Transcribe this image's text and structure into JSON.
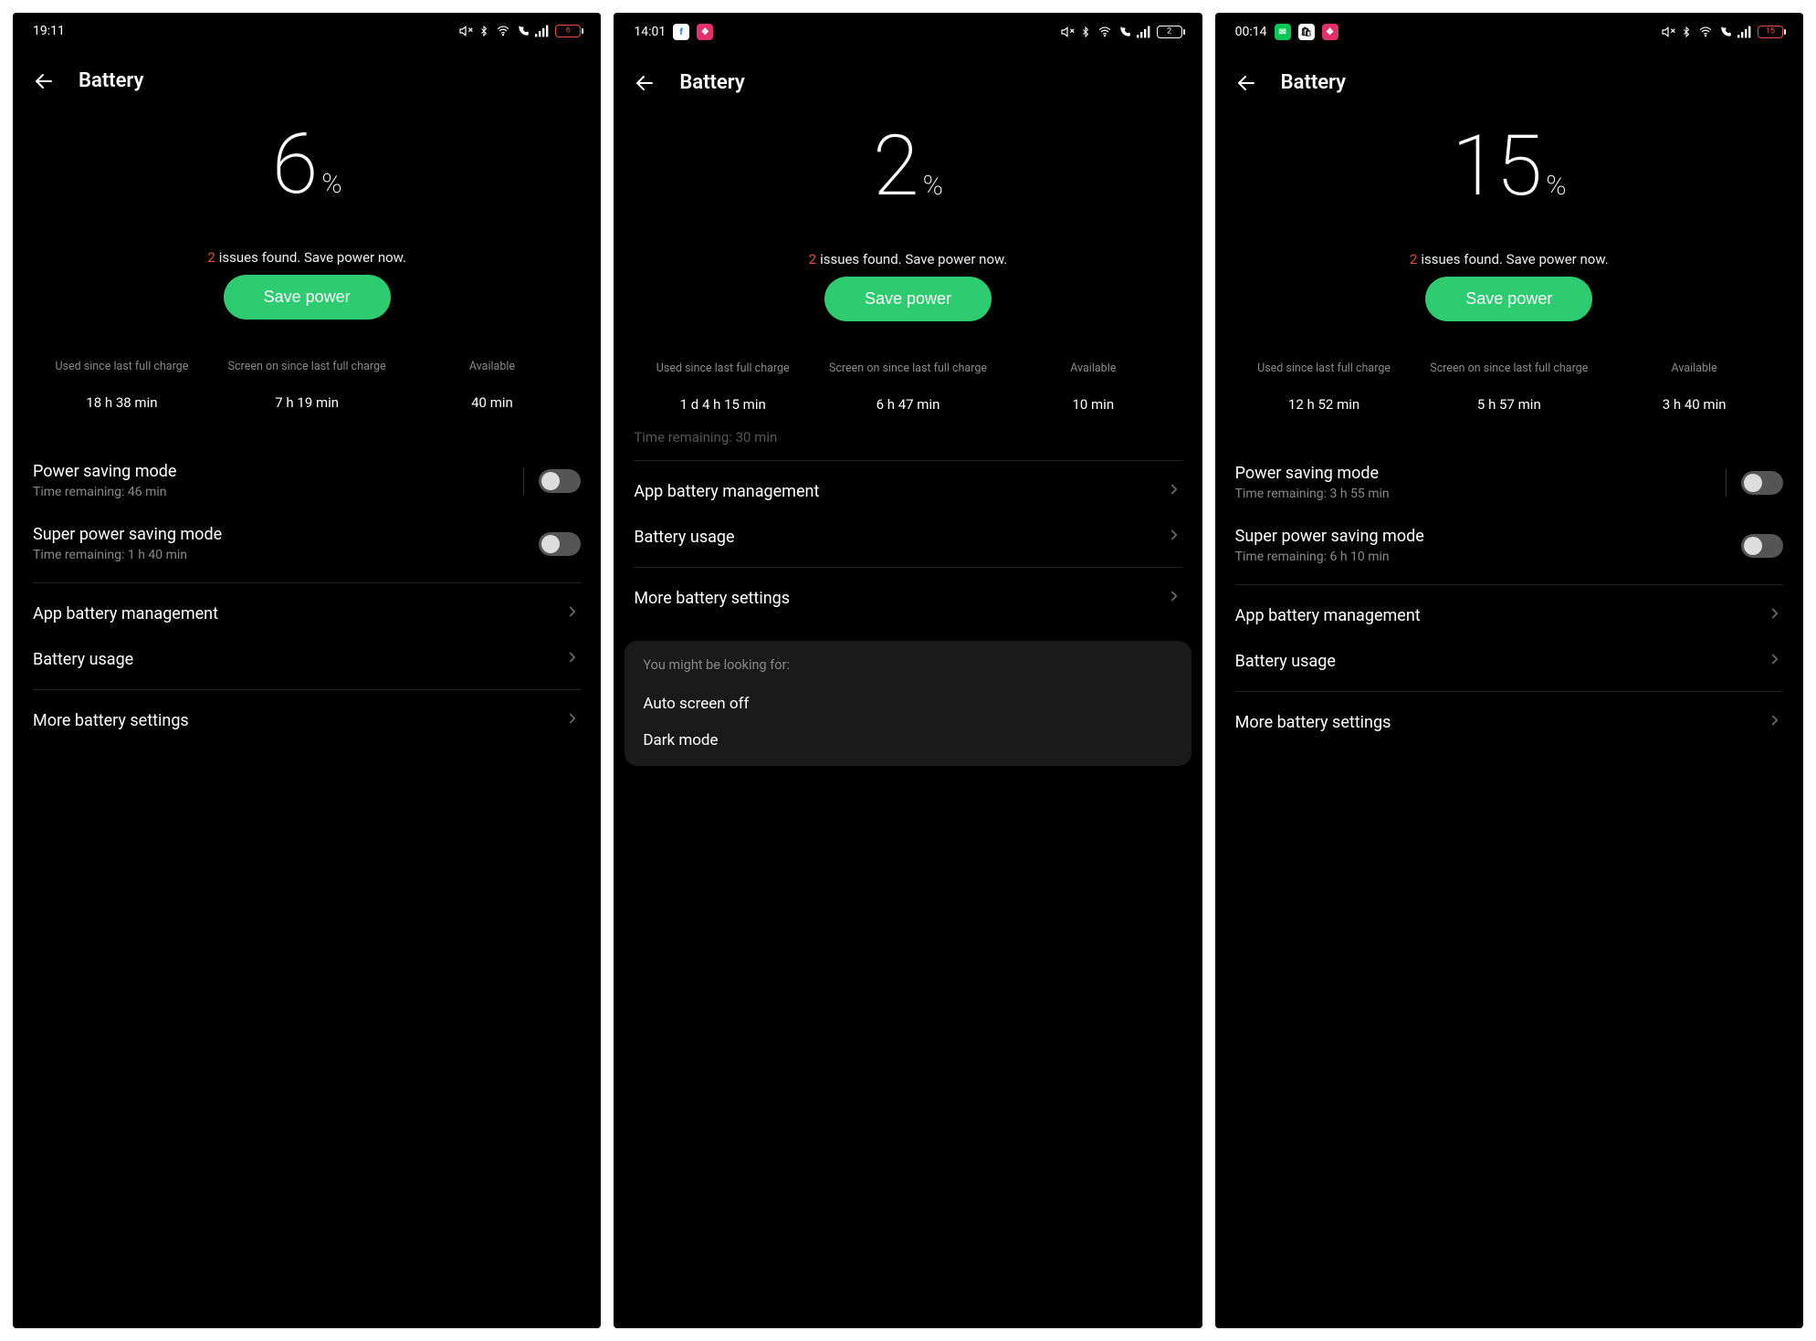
{
  "screens": [
    {
      "status": {
        "time": "19:11",
        "apps": [],
        "batt_level": "6",
        "batt_red": true
      },
      "header": {
        "title": "Battery"
      },
      "battery_pct": "6",
      "issues_count": "2",
      "issues_text": "issues found. Save power now.",
      "save_label": "Save power",
      "stats": {
        "used_label": "Used since last full charge",
        "used_value": "18 h 38 min",
        "screen_label": "Screen on since last full charge",
        "screen_value": "7 h 19 min",
        "avail_label": "Available",
        "avail_value": "40 min"
      },
      "partial_row_visible": false,
      "partial_row_text": "",
      "toggles_visible": true,
      "toggles": [
        {
          "title": "Power saving mode",
          "sub": "Time remaining:  46 min",
          "with_sep": true
        },
        {
          "title": "Super power saving mode",
          "sub": "Time remaining:  1 h 40 min",
          "with_sep": false
        }
      ],
      "links": [
        {
          "title": "App battery management"
        },
        {
          "title": "Battery usage"
        }
      ],
      "more_label": "More battery settings",
      "suggest_visible": false,
      "suggest_title": "",
      "suggest_items": []
    },
    {
      "status": {
        "time": "14:01",
        "apps": [
          "fb",
          "ig"
        ],
        "batt_level": "2",
        "batt_red": false
      },
      "header": {
        "title": "Battery"
      },
      "battery_pct": "2",
      "issues_count": "2",
      "issues_text": "issues found. Save power now.",
      "save_label": "Save power",
      "stats": {
        "used_label": "Used since last full charge",
        "used_value": "1 d 4 h 15 min",
        "screen_label": "Screen on since last full charge",
        "screen_value": "6 h 47 min",
        "avail_label": "Available",
        "avail_value": "10 min"
      },
      "partial_row_visible": true,
      "partial_row_text": "Time remaining:  30 min",
      "toggles_visible": false,
      "toggles": [],
      "links": [
        {
          "title": "App battery management"
        },
        {
          "title": "Battery usage"
        }
      ],
      "more_label": "More battery settings",
      "suggest_visible": true,
      "suggest_title": "You might be looking for:",
      "suggest_items": [
        "Auto screen off",
        "Dark mode"
      ]
    },
    {
      "status": {
        "time": "00:14",
        "apps": [
          "line",
          "shop",
          "ig"
        ],
        "batt_level": "15",
        "batt_red": true
      },
      "header": {
        "title": "Battery"
      },
      "battery_pct": "15",
      "issues_count": "2",
      "issues_text": "issues found. Save power now.",
      "save_label": "Save power",
      "stats": {
        "used_label": "Used since last full charge",
        "used_value": "12 h 52 min",
        "screen_label": "Screen on since last full charge",
        "screen_value": "5 h 57 min",
        "avail_label": "Available",
        "avail_value": "3 h 40 min"
      },
      "partial_row_visible": false,
      "partial_row_text": "",
      "toggles_visible": true,
      "toggles": [
        {
          "title": "Power saving mode",
          "sub": "Time remaining:  3 h 55 min",
          "with_sep": true
        },
        {
          "title": "Super power saving mode",
          "sub": "Time remaining:  6 h 10 min",
          "with_sep": false
        }
      ],
      "links": [
        {
          "title": "App battery management"
        },
        {
          "title": "Battery usage"
        }
      ],
      "more_label": "More battery settings",
      "suggest_visible": false,
      "suggest_title": "",
      "suggest_items": []
    }
  ]
}
